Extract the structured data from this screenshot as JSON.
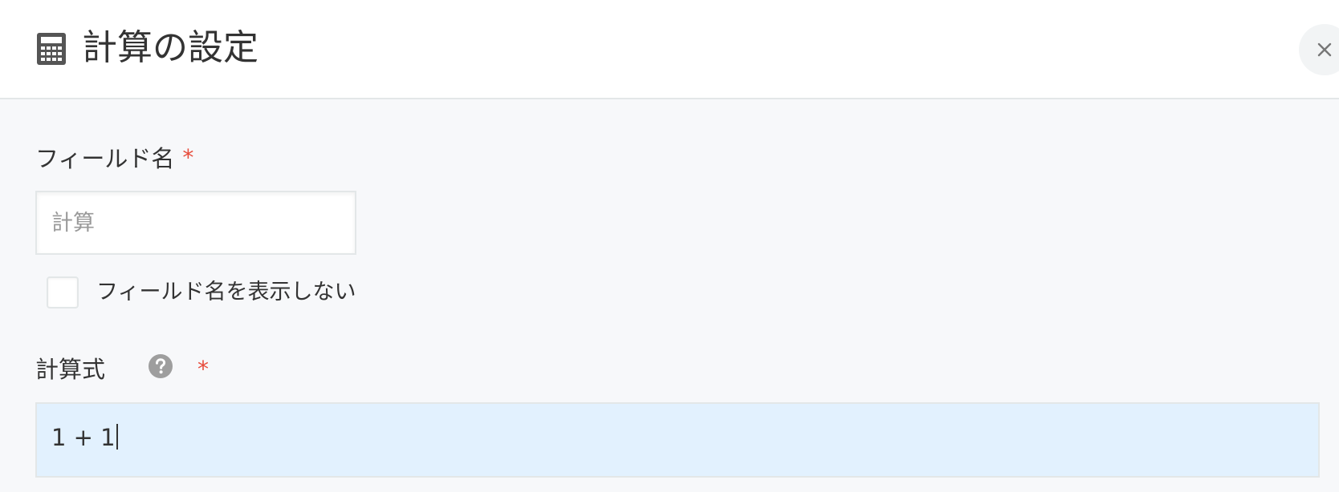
{
  "dialog": {
    "title": "計算の設定",
    "header_icon": "calculator-icon",
    "close_icon": "close-icon"
  },
  "field_name": {
    "label": "フィールド名",
    "required_mark": "*",
    "value": "",
    "placeholder": "計算"
  },
  "hide_field_name": {
    "label": "フィールド名を表示しない",
    "checked": false
  },
  "formula": {
    "label": "計算式",
    "help_icon": "question-circle-icon",
    "required_mark": "*",
    "value": "1 + 1"
  },
  "colors": {
    "required": "#e74c3c",
    "formula_background": "#e2f1fe",
    "body_background": "#f7f8fa"
  }
}
